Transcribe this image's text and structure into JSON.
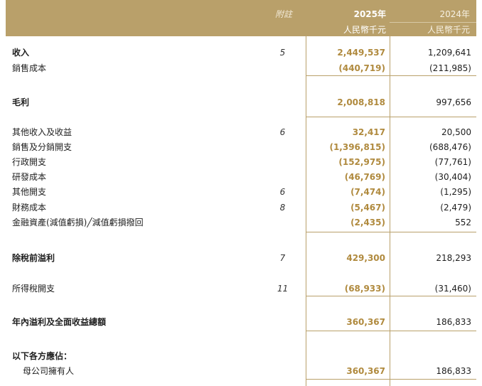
{
  "header": {
    "note_col": "附註",
    "year_2025": "2025年",
    "unit_2025": "人民幣千元",
    "year_2024": "2024年",
    "unit_2024": "人民幣千元"
  },
  "rows": [
    {
      "label": "收入",
      "note": "5",
      "v2025": "2,449,537",
      "v2024": "1,209,641"
    },
    {
      "label": "銷售成本",
      "note": "",
      "v2025": "(440,719)",
      "v2024": "(211,985)"
    },
    {
      "label": "毛利",
      "note": "",
      "v2025": "2,008,818",
      "v2024": "997,656"
    },
    {
      "label": "其他收入及收益",
      "note": "6",
      "v2025": "32,417",
      "v2024": "20,500"
    },
    {
      "label": "銷售及分銷開支",
      "note": "",
      "v2025": "(1,396,815)",
      "v2024": "(688,476)"
    },
    {
      "label": "行政開支",
      "note": "",
      "v2025": "(152,975)",
      "v2024": "(77,761)"
    },
    {
      "label": "研發成本",
      "note": "",
      "v2025": "(46,769)",
      "v2024": "(30,404)"
    },
    {
      "label": "其他開支",
      "note": "6",
      "v2025": "(7,474)",
      "v2024": "(1,295)"
    },
    {
      "label": "財務成本",
      "note": "8",
      "v2025": "(5,467)",
      "v2024": "(2,479)"
    },
    {
      "label": "金融資產(減值虧損)╱減值虧損撥回",
      "note": "",
      "v2025": "(2,435)",
      "v2024": "552"
    },
    {
      "label": "除稅前溢利",
      "note": "7",
      "v2025": "429,300",
      "v2024": "218,293"
    },
    {
      "label": "所得稅開支",
      "note": "11",
      "v2025": "(68,933)",
      "v2024": "(31,460)"
    },
    {
      "label": "年內溢利及全面收益總額",
      "note": "",
      "v2025": "360,367",
      "v2024": "186,833"
    },
    {
      "label": "以下各方應佔：",
      "note": "",
      "v2025": "",
      "v2024": ""
    },
    {
      "label": "母公司擁有人",
      "note": "",
      "v2025": "360,367",
      "v2024": "186,833"
    }
  ]
}
